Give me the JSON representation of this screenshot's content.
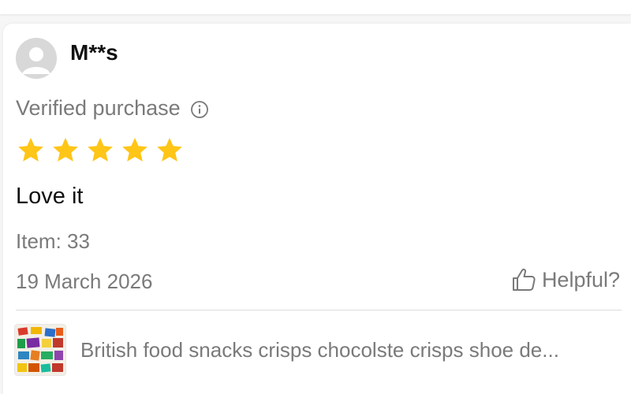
{
  "reviewer": {
    "name": "M**s"
  },
  "verification": {
    "label": "Verified purchase",
    "info_icon": "info-circle-icon"
  },
  "rating": {
    "stars": 5,
    "max": 5,
    "star_color": "#FFC517"
  },
  "review": {
    "text": "Love it",
    "item": "Item: 33",
    "date": "19 March 2026"
  },
  "helpful": {
    "label": "Helpful?",
    "icon": "thumbs-up-icon"
  },
  "product": {
    "title": "British food snacks crisps chocolste crisps shoe de..."
  },
  "colors": {
    "text_primary": "#111111",
    "text_secondary": "#7A7A7A",
    "divider": "#DCDCDC",
    "avatar_bg": "#D8D8D8"
  }
}
